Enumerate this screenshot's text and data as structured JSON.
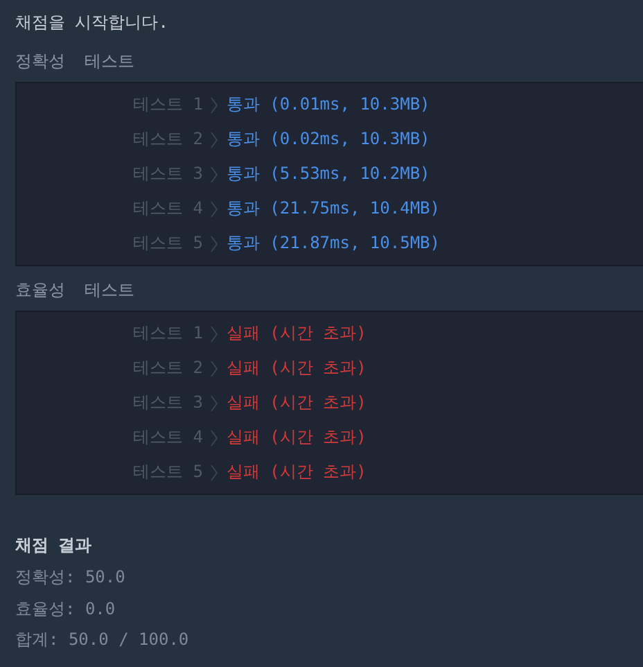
{
  "intro": "채점을 시작합니다.",
  "sections": [
    {
      "category": "정확성",
      "label": "테스트",
      "tests": [
        {
          "name": "테스트 1",
          "result": "통과 (0.01ms, 10.3MB)",
          "kind": "pass"
        },
        {
          "name": "테스트 2",
          "result": "통과 (0.02ms, 10.3MB)",
          "kind": "pass"
        },
        {
          "name": "테스트 3",
          "result": "통과 (5.53ms, 10.2MB)",
          "kind": "pass"
        },
        {
          "name": "테스트 4",
          "result": "통과 (21.75ms, 10.4MB)",
          "kind": "pass"
        },
        {
          "name": "테스트 5",
          "result": "통과 (21.87ms, 10.5MB)",
          "kind": "pass"
        }
      ]
    },
    {
      "category": "효율성",
      "label": "테스트",
      "tests": [
        {
          "name": "테스트 1",
          "result": "실패 (시간 초과)",
          "kind": "fail"
        },
        {
          "name": "테스트 2",
          "result": "실패 (시간 초과)",
          "kind": "fail"
        },
        {
          "name": "테스트 3",
          "result": "실패 (시간 초과)",
          "kind": "fail"
        },
        {
          "name": "테스트 4",
          "result": "실패 (시간 초과)",
          "kind": "fail"
        },
        {
          "name": "테스트 5",
          "result": "실패 (시간 초과)",
          "kind": "fail"
        }
      ]
    }
  ],
  "summary": {
    "title": "채점 결과",
    "lines": [
      "정확성: 50.0",
      "효율성: 0.0",
      "합계: 50.0 / 100.0"
    ]
  }
}
